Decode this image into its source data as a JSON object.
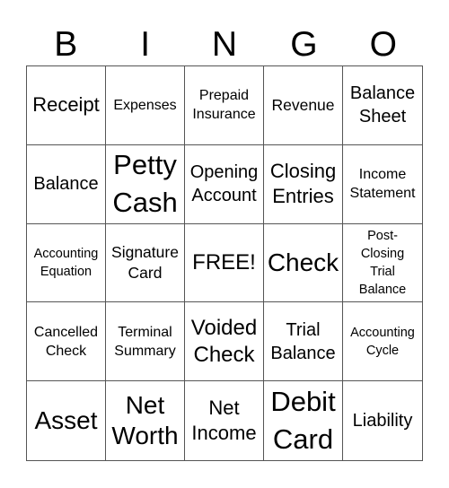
{
  "header": [
    "B",
    "I",
    "N",
    "G",
    "O"
  ],
  "cells": [
    {
      "text": "Receipt",
      "size": "s22"
    },
    {
      "text": "Expenses",
      "size": "s16"
    },
    {
      "text": "Prepaid\nInsurance",
      "size": "s16"
    },
    {
      "text": "Revenue",
      "size": "s17"
    },
    {
      "text": "Balance\nSheet",
      "size": "s20"
    },
    {
      "text": "Balance",
      "size": "s20"
    },
    {
      "text": "Petty\nCash",
      "size": "s31"
    },
    {
      "text": "Opening\nAccount",
      "size": "s20"
    },
    {
      "text": "Closing\nEntries",
      "size": "s22"
    },
    {
      "text": "Income\nStatement",
      "size": "s16"
    },
    {
      "text": "Accounting\nEquation",
      "size": "s14"
    },
    {
      "text": "Signature\nCard",
      "size": "s17"
    },
    {
      "text": "FREE!",
      "size": "s24"
    },
    {
      "text": "Check",
      "size": "s28"
    },
    {
      "text": "Post-\nClosing\nTrial\nBalance",
      "size": "s14"
    },
    {
      "text": "Cancelled\nCheck",
      "size": "s16"
    },
    {
      "text": "Terminal\nSummary",
      "size": "s16"
    },
    {
      "text": "Voided\nCheck",
      "size": "s24"
    },
    {
      "text": "Trial\nBalance",
      "size": "s20"
    },
    {
      "text": "Accounting\nCycle",
      "size": "s14"
    },
    {
      "text": "Asset",
      "size": "s28"
    },
    {
      "text": "Net\nWorth",
      "size": "s28"
    },
    {
      "text": "Net\nIncome",
      "size": "s22"
    },
    {
      "text": "Debit\nCard",
      "size": "s31"
    },
    {
      "text": "Liability",
      "size": "s20"
    }
  ]
}
